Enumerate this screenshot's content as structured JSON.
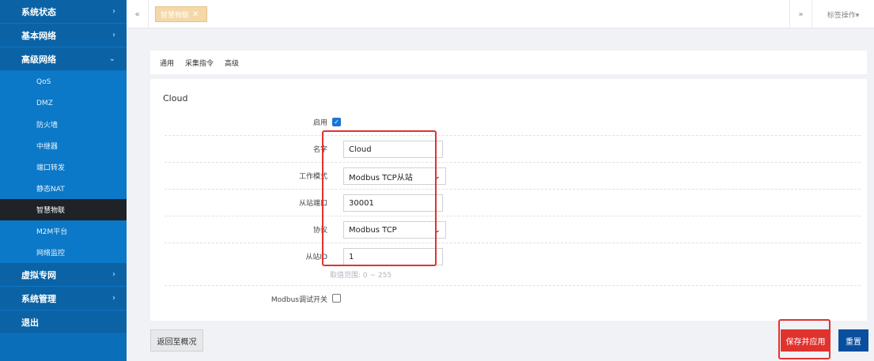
{
  "sidebar": {
    "top_items": [
      {
        "label": "系统状态",
        "chevron": "›"
      },
      {
        "label": "基本网络",
        "chevron": "›"
      },
      {
        "label": "高级网络",
        "chevron": "⌄"
      }
    ],
    "sub_items": [
      {
        "label": "QoS"
      },
      {
        "label": "DMZ"
      },
      {
        "label": "防火墙"
      },
      {
        "label": "中继器"
      },
      {
        "label": "端口转发"
      },
      {
        "label": "静态NAT"
      },
      {
        "label": "智慧物联"
      },
      {
        "label": "M2M平台"
      },
      {
        "label": "网络监控"
      }
    ],
    "bottom_items": [
      {
        "label": "虚拟专网",
        "chevron": "›"
      },
      {
        "label": "系统管理",
        "chevron": "›"
      },
      {
        "label": "退出"
      }
    ]
  },
  "tabbar": {
    "left_arrow": "«",
    "right_arrow": "»",
    "active_tab": "智慧物联",
    "close_glyph": "✕",
    "menu_label": "标签操作▾"
  },
  "subtabs": [
    "通用",
    "采集指令",
    "高级"
  ],
  "form": {
    "section_title": "Cloud",
    "enable_label": "启用",
    "name_label": "名字",
    "name_value": "Cloud",
    "mode_label": "工作模式",
    "mode_value": "Modbus TCP从站",
    "port_label": "从站端口",
    "port_value": "30001",
    "protocol_label": "协议",
    "protocol_value": "Modbus TCP",
    "slave_id_label": "从站ID",
    "slave_id_value": "1",
    "range_hint": "取值范围: 0 ~ 255",
    "debug_label": "Modbus调试开关"
  },
  "actions": {
    "back": "返回至概况",
    "save": "保存并应用",
    "reset": "重置"
  },
  "colors": {
    "sidebar": "#0a6eb8",
    "accent_red": "#e0332e",
    "reset_blue": "#0a4f9e",
    "active_tab": "#f4d8a8"
  }
}
